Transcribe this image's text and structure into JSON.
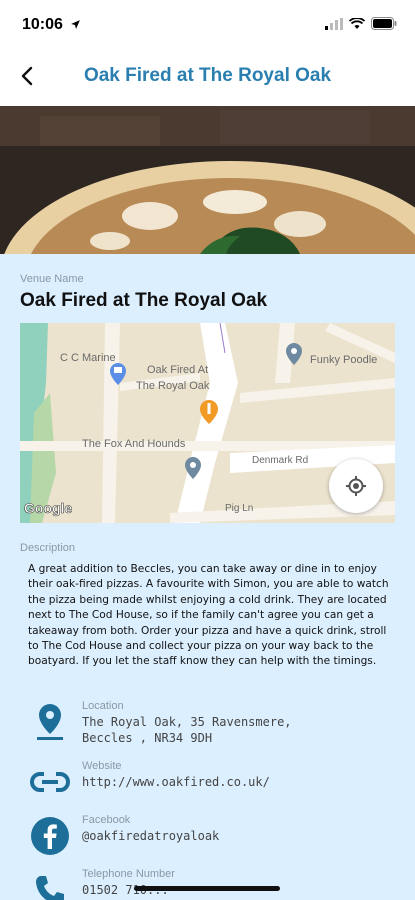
{
  "status_bar": {
    "time": "10:06"
  },
  "header": {
    "title": "Oak Fired at The Royal Oak",
    "back_icon": "chevron-left-icon"
  },
  "venue": {
    "label": "Venue Name",
    "name": "Oak Fired at The Royal Oak"
  },
  "map": {
    "labels": {
      "cc_marine": "C C Marine",
      "oak_fired_line1": "Oak Fired At",
      "oak_fired_line2": "The Royal Oak",
      "fox_hounds": "The Fox And Hounds",
      "funky_poodle": "Funky Poodle",
      "denmark_rd": "Denmark Rd",
      "pig_ln": "Pig Ln",
      "google": "Google"
    },
    "locate_icon": "my-location-icon"
  },
  "description": {
    "label": "Description",
    "text": "A great addition to Beccles, you can take away or dine in to enjoy their oak-fired pizzas. A favourite with Simon, you are able to watch the pizza being made whilst enjoying a cold drink. They are located next to The Cod House, so if the family can't agree you can get a takeaway from both. Order your pizza and have a quick drink, stroll to The Cod House and collect your pizza on your way back to the boatyard. If you let the staff know they can help with the timings."
  },
  "details": [
    {
      "label": "Location",
      "line1": "The Royal Oak, 35 Ravensmere,",
      "line2": "Beccles , NR34 9DH",
      "icon": "location-pin-icon"
    },
    {
      "label": "Website",
      "line1": "http://www.oakfired.co.uk/",
      "line2": "",
      "icon": "link-icon"
    },
    {
      "label": "Facebook",
      "line1": "@oakfiredatroyaloak",
      "line2": "",
      "icon": "facebook-icon"
    },
    {
      "label": "Telephone Number",
      "line1": "01502 710...",
      "line2": "",
      "icon": "phone-icon"
    }
  ],
  "colors": {
    "accent": "#2a7fb0",
    "icon_blue": "#1d6f99",
    "background": "#dcefff"
  }
}
